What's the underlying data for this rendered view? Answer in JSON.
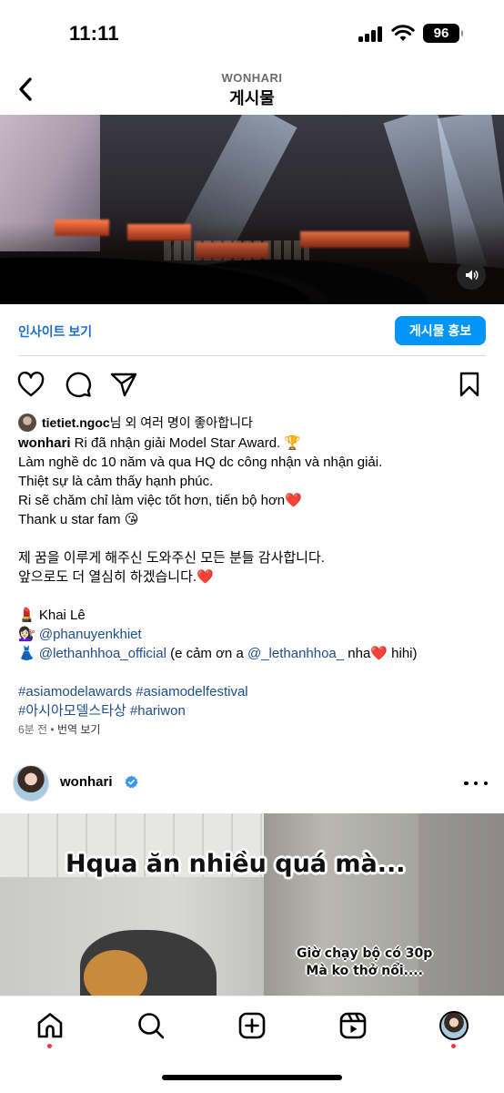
{
  "status": {
    "time": "11:11",
    "battery": "96"
  },
  "header": {
    "username": "WONHARI",
    "title": "게시물"
  },
  "insights": {
    "link_label": "인사이트 보기",
    "promote_label": "게시물 홍보"
  },
  "post": {
    "likes": {
      "username": "tietiet.ngoc",
      "text": "님 외 여러 명이 좋아합니다"
    },
    "caption": {
      "author": "wonhari",
      "line1": " Ri đã nhận giải Model Star Award. 🏆",
      "line2": "Làm nghề dc 10 năm và qua HQ dc công nhận và nhận giải.",
      "line3": "Thiệt sự là cảm thấy hạnh phúc.",
      "line4": "Ri sẽ chăm chỉ làm việc tốt hơn, tiến bộ hơn❤️",
      "line5": "Thank u star fam 😘",
      "line6": "제 꿈을 이루게 해주신 도와주신 모든 분들 감사합니다.",
      "line7": "앞으로도 더 열심히 하겠습니다.❤️",
      "credit1": "💄 Khai Lê",
      "credit2_icon": "💇🏻‍♀️ ",
      "credit2_mention": "@phanuyenkhiet",
      "credit3_icon": "👗 ",
      "credit3_mention": "@lethanhhoa_official",
      "credit3_text1": " (e cảm ơn a ",
      "credit3_mention2": "@_lethanhhoa_",
      "credit3_text2": "  nha❤️ hihi)",
      "hashtags1": "#asiamodelawards #asiamodelfestival",
      "hashtags2": "#아시아모델스타상 #hariwon"
    },
    "time_ago": "6분 전",
    "separator": " • ",
    "translate_label": "번역 보기"
  },
  "next_post": {
    "username": "wonhari",
    "overlay_title": "Hqua ăn nhiều quá mà...",
    "overlay_line1": "Giờ chạy bộ có 30p",
    "overlay_line2": "Mà ko thở nổi...."
  },
  "icons": {
    "back": "chevron-left-icon",
    "sound": "speaker-icon",
    "like": "heart-icon",
    "comment": "comment-icon",
    "share": "paper-plane-icon",
    "save": "bookmark-icon",
    "verified": "verified-badge-icon",
    "more": "ellipsis-icon",
    "nav": [
      "home-icon",
      "search-icon",
      "create-icon",
      "reels-icon",
      "profile-avatar"
    ]
  },
  "colors": {
    "primary_blue": "#0095f6",
    "link_blue": "#1e6ec8",
    "mention_blue": "#1e4f8a",
    "notification_red": "#ff3040"
  }
}
